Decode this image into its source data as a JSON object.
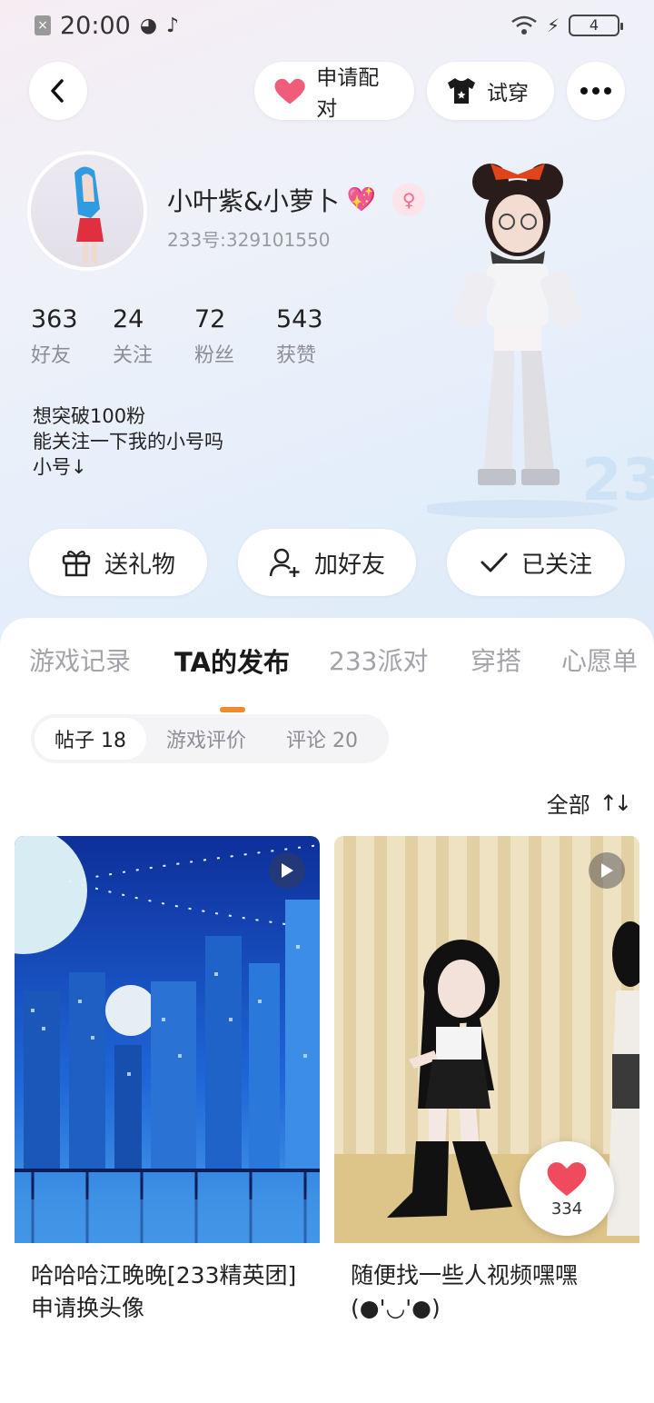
{
  "status_bar": {
    "time": "20:00",
    "battery": "4"
  },
  "header": {
    "pair_label": "申请配对",
    "tryon_label": "试穿"
  },
  "profile": {
    "name": "小叶紫&小萝卜",
    "name_emoji": "💖",
    "gender_icon": "female-icon",
    "uid": "233号:329101550",
    "stats": [
      {
        "value": "363",
        "label": "好友"
      },
      {
        "value": "24",
        "label": "关注"
      },
      {
        "value": "72",
        "label": "粉丝"
      },
      {
        "value": "543",
        "label": "获赞"
      }
    ],
    "bio_lines": [
      "想突破100粉",
      "能关注一下我的小号吗",
      "小号↓"
    ]
  },
  "actions": {
    "gift_label": "送礼物",
    "add_friend_label": "加好友",
    "follow_label": "已关注"
  },
  "tabs": [
    {
      "label": "游戏记录",
      "active": false
    },
    {
      "label": "TA的发布",
      "active": true
    },
    {
      "label": "233派对",
      "active": false
    },
    {
      "label": "穿搭",
      "active": false
    },
    {
      "label": "心愿单",
      "active": false
    }
  ],
  "subtabs": [
    {
      "label": "帖子 18",
      "active": true
    },
    {
      "label": "游戏评价",
      "active": false
    },
    {
      "label": "评论 20",
      "active": false
    }
  ],
  "sort_label": "全部",
  "posts": [
    {
      "title": "哈哈哈江晚晚[233精英团]申请换头像",
      "type": "video"
    },
    {
      "title": "随便找一些人视频嘿嘿(●'◡'●)",
      "type": "video"
    }
  ],
  "like_count": "334",
  "colors": {
    "accent": "#f08a2c",
    "heart": "#f04a5e"
  }
}
